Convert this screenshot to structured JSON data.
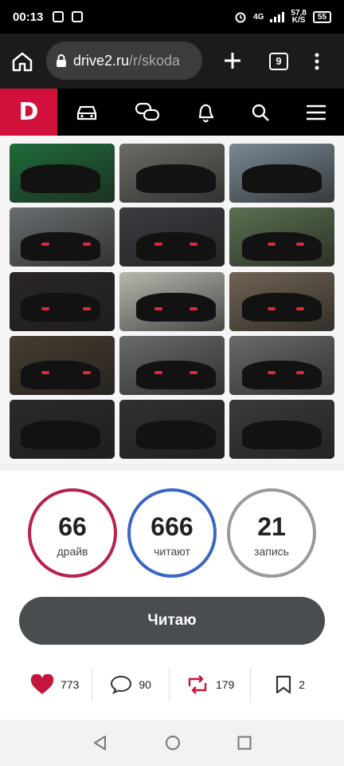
{
  "status_bar": {
    "time": "00:13",
    "network": "4G",
    "speed": "57,8",
    "speed_unit": "K/S",
    "battery": "55"
  },
  "browser": {
    "url_host": "drive2.ru",
    "url_path": "/r/skoda",
    "tab_count": "9"
  },
  "site_nav": {
    "logo": "D",
    "items": [
      "car-icon",
      "chat-icon",
      "bell-icon",
      "search-icon",
      "menu-icon"
    ]
  },
  "photo_grid": {
    "rows": 5,
    "columns": 3,
    "tile_colors": [
      [
        "#1f6b3a",
        "#6c6c66",
        "#7a8994"
      ],
      [
        "#6a6e70",
        "#3a3c40",
        "#5a7050"
      ],
      [
        "#2a2626",
        "#b8b8b0",
        "#6f6454"
      ],
      [
        "#463c30",
        "#6a6a68",
        "#6a6a6c"
      ],
      [
        "#2a2a2a",
        "#303030",
        "#3a3a3a"
      ]
    ]
  },
  "stats": {
    "drive": {
      "value": "66",
      "label": "драйв"
    },
    "readers": {
      "value": "666",
      "label": "читают"
    },
    "posts": {
      "value": "21",
      "label": "запись"
    }
  },
  "read_button": "Читаю",
  "actions": {
    "likes": "773",
    "comments": "90",
    "reposts": "179",
    "bookmarks": "2"
  },
  "colors": {
    "brand": "#d1103c",
    "drive_ring": "#b8224d",
    "readers_ring": "#3a66c4",
    "posts_ring": "#9a9a9a"
  }
}
